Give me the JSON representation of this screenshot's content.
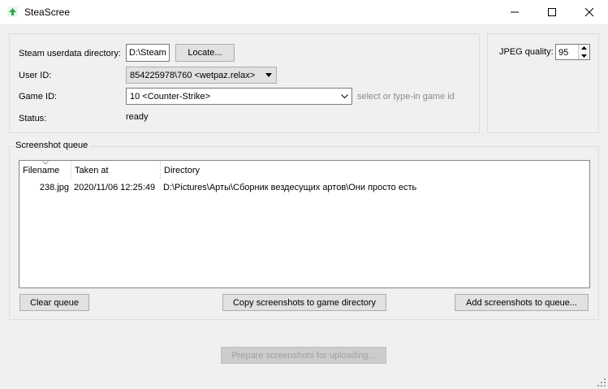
{
  "window": {
    "title": "SteaScree"
  },
  "settings": {
    "userdata_label": "Steam userdata directory:",
    "userdata_value": "D:\\Steam",
    "locate_button": "Locate...",
    "user_id_label": "User ID:",
    "user_id_value": "854225978\\760 <wetpaz.relax>",
    "game_id_label": "Game ID:",
    "game_id_value": "10 <Counter-Strike>",
    "game_id_hint": "select or type-in game id",
    "status_label": "Status:",
    "status_value": "ready"
  },
  "jpeg": {
    "label": "JPEG quality:",
    "value": "95"
  },
  "queue": {
    "title": "Screenshot queue",
    "columns": [
      "Filename",
      "Taken at",
      "Directory"
    ],
    "rows": [
      {
        "filename": "238.jpg",
        "taken_at": "2020/11/06 12:25:49",
        "directory": "D:\\Pictures\\Арты\\Сборник вездесущих артов\\Они просто есть"
      }
    ],
    "clear_button": "Clear queue",
    "copy_button": "Copy screenshots to game directory",
    "add_button": "Add screenshots to queue..."
  },
  "prepare_button": "Prepare screenshots for uploading...",
  "colors": {
    "app_icon_green": "#2eaa4a",
    "focus_blue": "#0078d7"
  }
}
